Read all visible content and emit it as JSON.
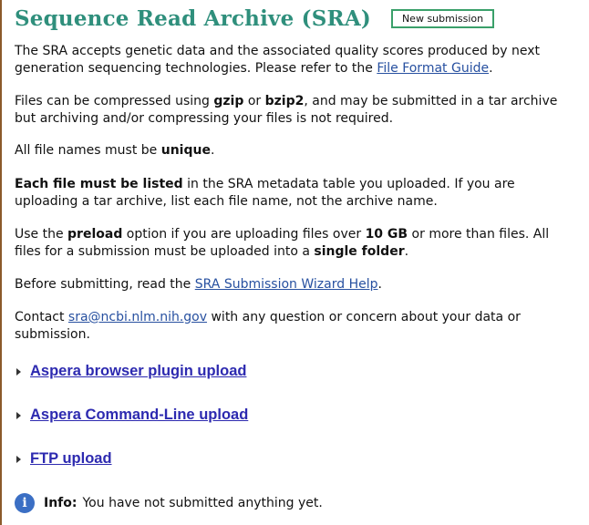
{
  "header": {
    "title": "Sequence Read Archive (SRA)",
    "new_submission_label": "New submission"
  },
  "paragraphs": {
    "p1": {
      "text": "The SRA accepts genetic data and the associated quality scores produced by next generation sequencing technologies. Please refer to the ",
      "link": "File Format Guide",
      "after": "."
    },
    "p2": {
      "t1": "Files can be compressed using ",
      "b1": "gzip",
      "t2": " or ",
      "b2": "bzip2",
      "t3": ", and may be submitted in a tar archive but archiving and/or compressing your files is not required."
    },
    "p3": {
      "t1": "All file names must be ",
      "b1": "unique",
      "t2": "."
    },
    "p4": {
      "b1": "Each file must be listed",
      "t1": " in the SRA metadata table you uploaded. If you are uploading a tar archive, list each file name, not the archive name."
    },
    "p5": {
      "t1": "Use the ",
      "b1": "preload",
      "t2": " option if you are uploading files over ",
      "b2": "10 GB",
      "t3": " or more than files. All files for a submission must be uploaded into a ",
      "b3": "single folder",
      "t4": "."
    },
    "p6": {
      "t1": "Before submitting, read the ",
      "link": "SRA Submission Wizard Help",
      "t2": "."
    },
    "p7": {
      "t1": "Contact ",
      "link": "sra@ncbi.nlm.nih.gov",
      "t2": " with any question or concern about your data or submission."
    }
  },
  "upload_options": [
    {
      "label": "Aspera browser plugin upload"
    },
    {
      "label": "Aspera Command-Line upload"
    },
    {
      "label": "FTP upload"
    }
  ],
  "info": {
    "icon": "info-icon",
    "label": "Info:",
    "text": "You have not submitted anything yet."
  },
  "colors": {
    "title": "#2f8f7c",
    "button_border": "#3aa06a",
    "link": "#2750a0",
    "expander_link": "#2d2ab0",
    "info_icon": "#3b6fc4"
  }
}
